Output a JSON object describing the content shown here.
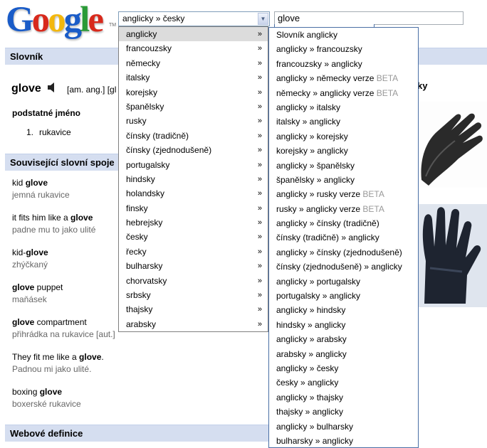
{
  "logo": {
    "text": "Google",
    "tm": "TM",
    "letter_colors": [
      "#1a5cc8",
      "#d8291c",
      "#f3b70d",
      "#1a5cc8",
      "#2a9a37",
      "#d8291c"
    ]
  },
  "lang_select": {
    "value": "anglicky » česky"
  },
  "search": {
    "value": "glove"
  },
  "sections": {
    "slovnik": "Slovník",
    "souvisejici": "Související slovní spoje",
    "web": "Webové definice"
  },
  "entry": {
    "word": "glove",
    "pron": "[am. ang.] [gl",
    "pos": "podstatné jméno",
    "sense_num": "1.",
    "sense_text": "rukavice",
    "right_text": "ky"
  },
  "phrases": [
    {
      "pre": "kid ",
      "bold": "glove",
      "post": "",
      "cz": "jemná rukavice"
    },
    {
      "pre": "it fits him like a ",
      "bold": "glove",
      "post": "",
      "cz": "padne mu to jako ulité"
    },
    {
      "pre": "kid-",
      "bold": "glove",
      "post": "",
      "cz": "zhýčkaný"
    },
    {
      "pre": "",
      "bold": "glove",
      "post": " puppet",
      "cz": "maňásek"
    },
    {
      "pre": "",
      "bold": "glove",
      "post": " compartment",
      "cz": "přihrádka na rukavice [aut.]"
    },
    {
      "pre": "They fit me like a ",
      "bold": "glove",
      "post": ".",
      "cz": "Padnou mi jako ulité."
    },
    {
      "pre": "boxing ",
      "bold": "glove",
      "post": "",
      "cz": "boxerské rukavice"
    }
  ],
  "source_langs": [
    "anglicky",
    "francouzsky",
    "německy",
    "italsky",
    "korejsky",
    "španělsky",
    "rusky",
    "čínsky (tradičně)",
    "čínsky (zjednodušeně)",
    "portugalsky",
    "hindsky",
    "holandsky",
    "finsky",
    "hebrejsky",
    "česky",
    "řecky",
    "bulharsky",
    "chorvatsky",
    "srbsky",
    "thajsky",
    "arabsky"
  ],
  "chevron": "»",
  "pairs": [
    {
      "text": "Slovník anglicky",
      "beta": ""
    },
    {
      "text": "anglicky » francouzsky",
      "beta": ""
    },
    {
      "text": "francouzsky » anglicky",
      "beta": ""
    },
    {
      "text": "anglicky » německy verze ",
      "beta": "BETA"
    },
    {
      "text": "německy » anglicky verze ",
      "beta": "BETA"
    },
    {
      "text": "anglicky » italsky",
      "beta": ""
    },
    {
      "text": "italsky » anglicky",
      "beta": ""
    },
    {
      "text": "anglicky » korejsky",
      "beta": ""
    },
    {
      "text": "korejsky » anglicky",
      "beta": ""
    },
    {
      "text": "anglicky » španělsky",
      "beta": ""
    },
    {
      "text": "španělsky » anglicky",
      "beta": ""
    },
    {
      "text": "anglicky » rusky verze ",
      "beta": "BETA"
    },
    {
      "text": "rusky » anglicky verze ",
      "beta": "BETA"
    },
    {
      "text": "anglicky » čínsky (tradičně)",
      "beta": ""
    },
    {
      "text": "čínsky (tradičně) » anglicky",
      "beta": ""
    },
    {
      "text": "anglicky » čínsky (zjednodušeně)",
      "beta": ""
    },
    {
      "text": "čínsky (zjednodušeně) » anglicky",
      "beta": ""
    },
    {
      "text": "anglicky » portugalsky",
      "beta": ""
    },
    {
      "text": "portugalsky » anglicky",
      "beta": ""
    },
    {
      "text": "anglicky » hindsky",
      "beta": ""
    },
    {
      "text": "hindsky » anglicky",
      "beta": ""
    },
    {
      "text": "anglicky » arabsky",
      "beta": ""
    },
    {
      "text": "arabsky » anglicky",
      "beta": ""
    },
    {
      "text": "anglicky » česky",
      "beta": ""
    },
    {
      "text": "česky » anglicky",
      "beta": ""
    },
    {
      "text": "anglicky » thajsky",
      "beta": ""
    },
    {
      "text": "thajsky » anglicky",
      "beta": ""
    },
    {
      "text": "anglicky » bulharsky",
      "beta": ""
    },
    {
      "text": "bulharsky » anglicky",
      "beta": ""
    }
  ]
}
